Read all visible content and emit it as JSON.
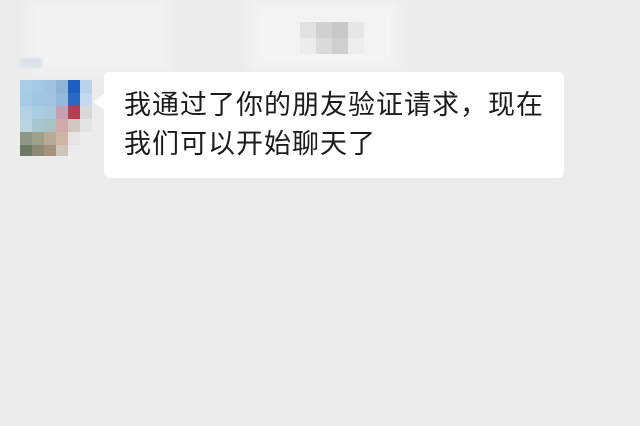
{
  "conversation": {
    "messages": [
      {
        "sender": "contact",
        "text": "我通过了你的朋友验证请求，现在我们可以开始聊天了"
      }
    ]
  },
  "colors": {
    "background": "#ececec",
    "bubble": "#ffffff",
    "text": "#1b1b1b"
  },
  "avatar": {
    "style": "pixelated"
  }
}
